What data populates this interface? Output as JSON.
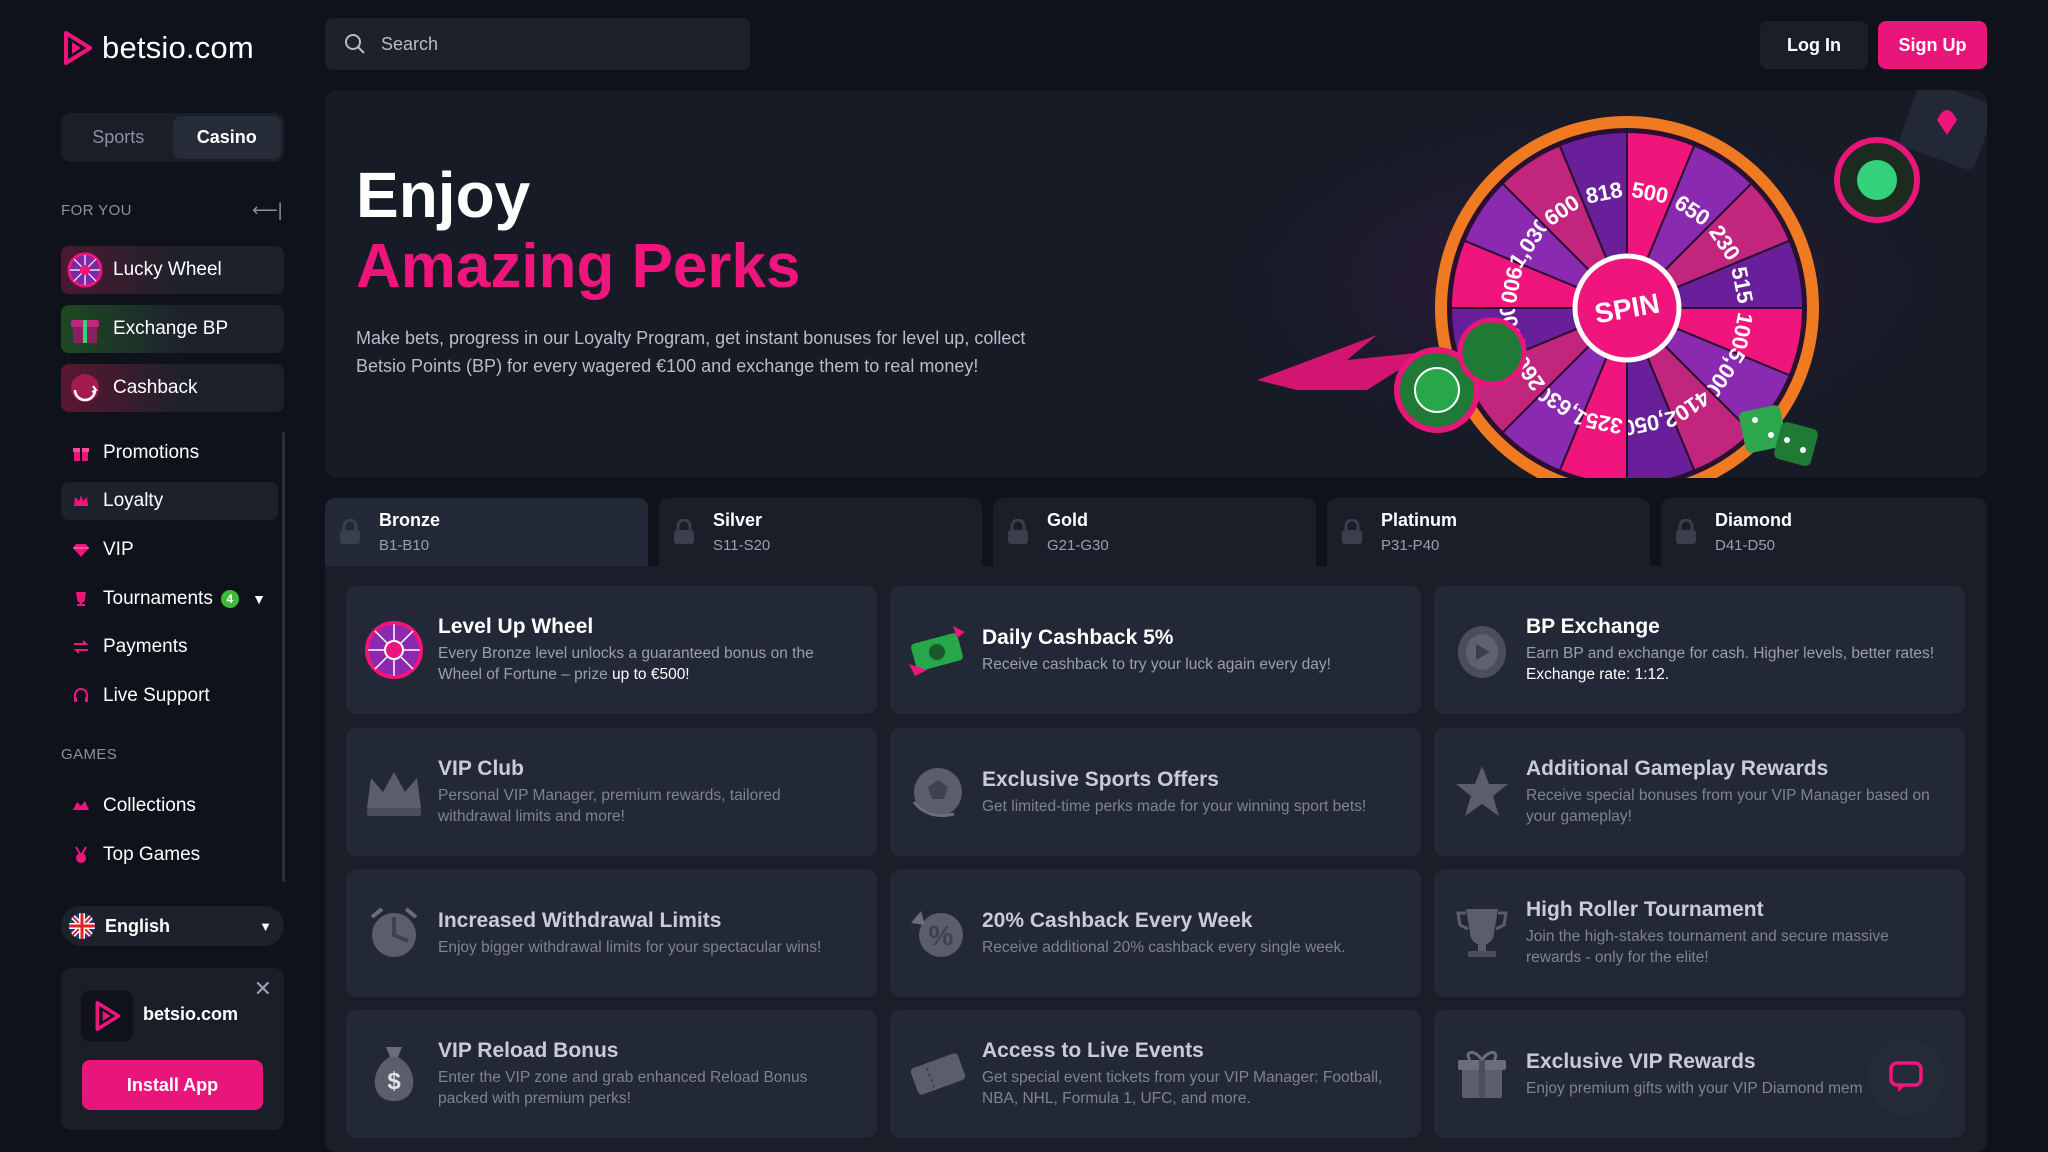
{
  "brand": {
    "name": "betsio.com",
    "accent": "#e8157a"
  },
  "sidebar": {
    "segments": [
      "Sports",
      "Casino"
    ],
    "for_you_label": "FOR YOU",
    "promo_items": [
      {
        "label": "Lucky Wheel",
        "icon": "wheel-icon"
      },
      {
        "label": "Exchange BP",
        "icon": "gift-box-icon"
      },
      {
        "label": "Cashback",
        "icon": "cashback-icon"
      }
    ],
    "nav_items": [
      {
        "label": "Promotions",
        "icon": "gift-icon"
      },
      {
        "label": "Loyalty",
        "icon": "crown-icon"
      },
      {
        "label": "VIP",
        "icon": "diamond-icon"
      },
      {
        "label": "Tournaments",
        "icon": "trophy-icon",
        "badge": "4"
      },
      {
        "label": "Payments",
        "icon": "payments-icon"
      },
      {
        "label": "Live Support",
        "icon": "headset-icon"
      }
    ],
    "games_label": "GAMES",
    "games_items": [
      {
        "label": "Collections",
        "icon": "collections-icon"
      },
      {
        "label": "Top Games",
        "icon": "medal-icon"
      }
    ],
    "language": "English",
    "install": {
      "app_name": "betsio.com",
      "button": "Install App"
    }
  },
  "header": {
    "search_placeholder": "Search",
    "login": "Log In",
    "signup": "Sign Up"
  },
  "hero": {
    "title": "Enjoy",
    "subtitle": "Amazing Perks",
    "description": "Make bets, progress in our Loyalty Program, get instant bonuses for level up, collect Betsio Points (BP) for every wagered €100 and exchange them to real money!",
    "wheel_center": "SPIN",
    "wheel_labels": [
      "500",
      "650",
      "230",
      "515",
      "100",
      "5,000",
      "410",
      "2,050",
      "325",
      "1,630",
      "260",
      "1,300",
      "006",
      "1,030",
      "600",
      "818"
    ]
  },
  "tiers": [
    {
      "name": "Bronze",
      "range": "B1-B10"
    },
    {
      "name": "Silver",
      "range": "S11-S20"
    },
    {
      "name": "Gold",
      "range": "G21-G30"
    },
    {
      "name": "Platinum",
      "range": "P31-P40"
    },
    {
      "name": "Diamond",
      "range": "D41-D50"
    }
  ],
  "perks": [
    {
      "title": "Level Up Wheel",
      "desc": "Every Bronze level unlocks a guaranteed bonus on the Wheel of Fortune – prize",
      "highlight": "up to €500!",
      "icon": "wheel-icon"
    },
    {
      "title": "Daily Cashback 5%",
      "desc": "Receive cashback to try your luck again every day!",
      "highlight": "",
      "icon": "cash-icon"
    },
    {
      "title": "BP Exchange",
      "desc": "Earn BP and exchange for cash. Higher levels, better rates!",
      "highlight": "Exchange rate: 1:12.",
      "icon": "coin-icon"
    },
    {
      "title": "VIP Club",
      "desc": "Personal VIP Manager, premium rewards, tailored withdrawal limits and more!",
      "highlight": "",
      "icon": "crown-icon"
    },
    {
      "title": "Exclusive Sports Offers",
      "desc": "Get limited-time perks made for your winning sport bets!",
      "highlight": "",
      "icon": "ball-icon"
    },
    {
      "title": "Additional Gameplay Rewards",
      "desc": "Receive special bonuses from your VIP Manager based on your gameplay!",
      "highlight": "",
      "icon": "star-icon"
    },
    {
      "title": "Increased Withdrawal Limits",
      "desc": "Enjoy bigger withdrawal limits for your spectacular wins!",
      "highlight": "",
      "icon": "limits-icon"
    },
    {
      "title": "20% Cashback Every Week",
      "desc": "Receive additional 20% cashback every single week.",
      "highlight": "",
      "icon": "percent-icon"
    },
    {
      "title": "High Roller Tournament",
      "desc": "Join the high-stakes tournament and secure massive rewards - only for the elite!",
      "highlight": "",
      "icon": "trophy-icon"
    },
    {
      "title": "VIP Reload Bonus",
      "desc": "Enter the VIP zone and grab enhanced Reload Bonus packed with premium perks!",
      "highlight": "",
      "icon": "money-bag-icon"
    },
    {
      "title": "Access to Live Events",
      "desc": "Get special event tickets from your VIP Manager: Football, NBA, NHL, Formula 1, UFC, and more.",
      "highlight": "",
      "icon": "ticket-icon"
    },
    {
      "title": "Exclusive VIP Rewards",
      "desc": "Enjoy premium gifts with your VIP Diamond mem",
      "highlight": "",
      "icon": "gift-icon"
    }
  ]
}
